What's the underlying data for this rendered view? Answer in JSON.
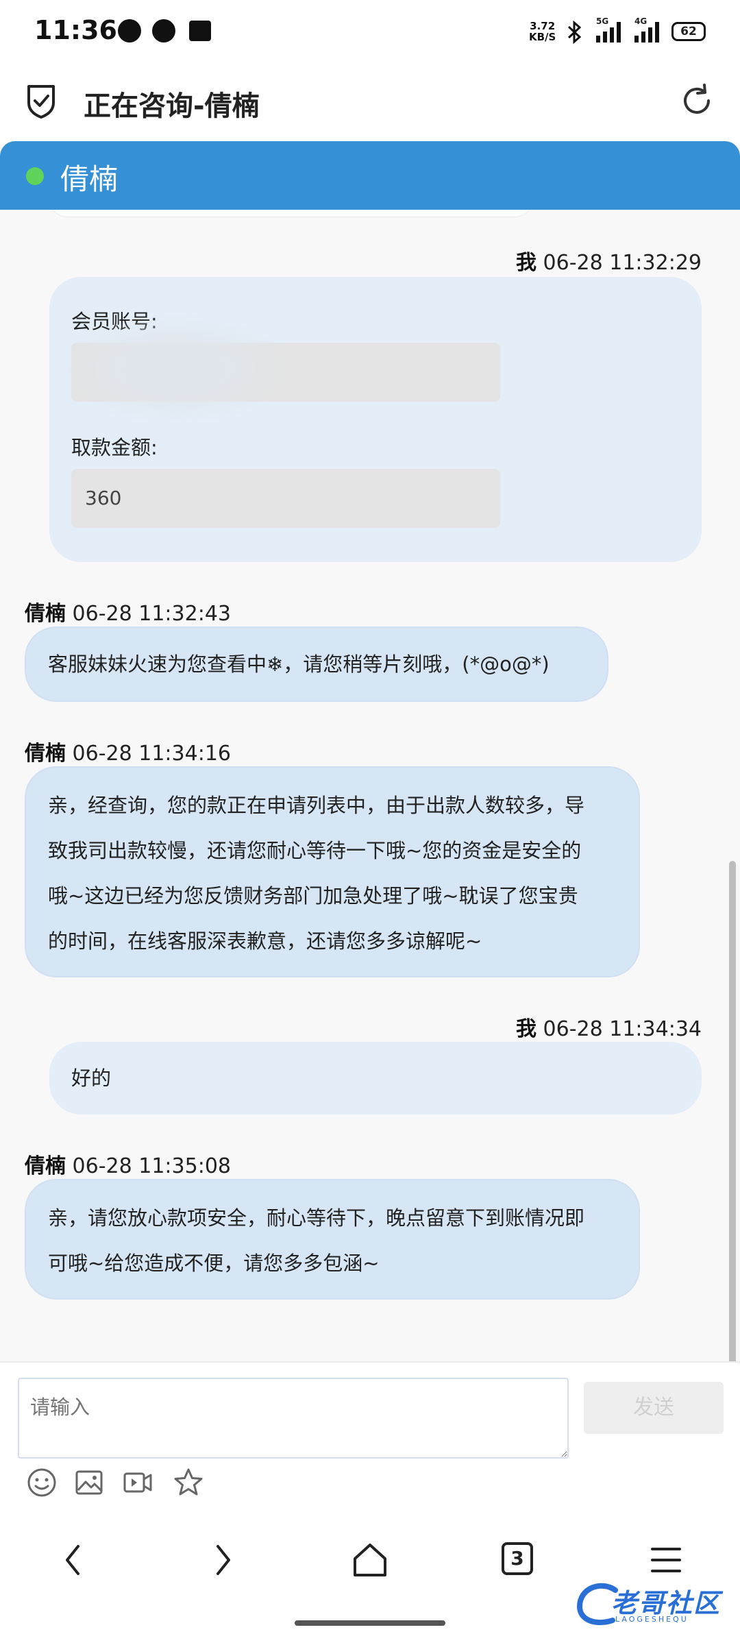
{
  "status_bar": {
    "time": "11:36",
    "net_speed_value": "3.72",
    "net_speed_unit": "KB/S",
    "signal_1_label": "5G",
    "signal_2_label": "4G",
    "battery": "62"
  },
  "app_bar": {
    "title": "正在咨询-倩楠"
  },
  "agent_header": {
    "name": "倩楠",
    "online_color": "#5fd35a",
    "bg_color": "#3590d6"
  },
  "messages": [
    {
      "sender": "我",
      "time": "06-28 11:32:29",
      "form": {
        "account_label": "会员账号:",
        "account_value": "",
        "amount_label": "取款金额:",
        "amount_value": "360"
      }
    },
    {
      "sender": "倩楠",
      "time": "06-28 11:32:43",
      "text": "客服妹妹火速为您查看中❄，请您稍等片刻哦，(*@o@*)"
    },
    {
      "sender": "倩楠",
      "time": "06-28 11:34:16",
      "lines": [
        "亲，经查询，您的款正在申请列表中，由于出款人数较多，导",
        "致我司出款较慢，还请您耐心等待一下哦~您的资金是安全的",
        "哦~这边已经为您反馈财务部门加急处理了哦~耽误了您宝贵",
        "的时间，在线客服深表歉意，还请您多多谅解呢~"
      ]
    },
    {
      "sender": "我",
      "time": "06-28 11:34:34",
      "text": "好的"
    },
    {
      "sender": "倩楠",
      "time": "06-28 11:35:08",
      "lines": [
        "亲，请您放心款项安全，耐心等待下，晚点留意下到账情况即",
        "可哦~给您造成不便，请您多多包涵~"
      ]
    }
  ],
  "input": {
    "placeholder": "请输入",
    "send_label": "发送"
  },
  "toolbar_icons": [
    "emoji-icon",
    "image-icon",
    "video-icon",
    "star-icon"
  ],
  "nav": {
    "tab_count": "3"
  },
  "watermark": {
    "text": "老哥社区",
    "sub": "LAOGESHEQU"
  }
}
